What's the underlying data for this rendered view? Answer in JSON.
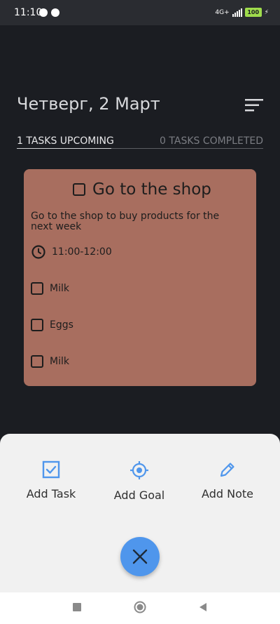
{
  "status_bar": {
    "time": "11:10",
    "network": "4G+",
    "battery": "100"
  },
  "header": {
    "date": "Четверг, 2 Март"
  },
  "tabs": {
    "upcoming": "1 TASKS UPCOMING",
    "completed": "0 TASKS COMPLETED"
  },
  "task": {
    "title": "Go to the shop",
    "description": "Go to the shop to buy products for the next week",
    "time": "11:00-12:00",
    "items": [
      "Milk",
      "Eggs",
      "Milk"
    ],
    "card_color": "#a86e5f"
  },
  "sheet": {
    "actions": [
      {
        "label": "Add Task",
        "icon": "checkbox-icon"
      },
      {
        "label": "Add Goal",
        "icon": "target-icon"
      },
      {
        "label": "Add Note",
        "icon": "pencil-icon"
      }
    ],
    "accent": "#4f96ec"
  },
  "nav": {
    "buttons": [
      "recent-apps-icon",
      "home-icon",
      "back-icon"
    ]
  }
}
